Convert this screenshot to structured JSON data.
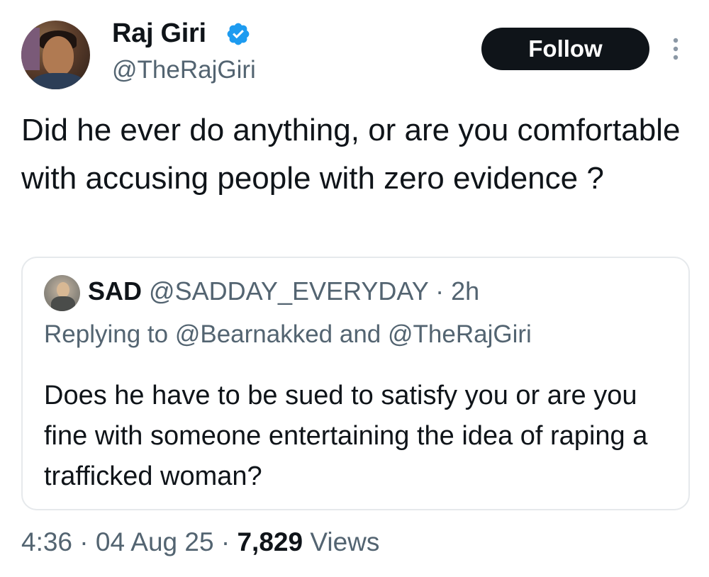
{
  "author": {
    "name": "Raj Giri",
    "handle": "@TheRajGiri",
    "verified": true
  },
  "actions": {
    "follow_label": "Follow"
  },
  "tweet": {
    "text": "Did he ever do anything, or are you comfortable with accusing people with zero evidence ?"
  },
  "quoted_tweet": {
    "name": "SAD",
    "handle": "@SADDAY_EVERYDAY",
    "separator": "·",
    "time": "2h",
    "replying_to": "Replying to @Bearnakked and @TheRajGiri",
    "text": "Does he have to be sued to satisfy you or are you fine with someone entertaining the idea of raping a trafficked woman?"
  },
  "footer": {
    "time": "4:36",
    "separator1": "·",
    "date": "04 Aug 25",
    "separator2": "·",
    "views_count": "7,829",
    "views_label": "Views"
  },
  "colors": {
    "verified_badge": "#1d9bf0",
    "follow_button_bg": "#0f1419",
    "secondary_text": "#536471",
    "quote_border": "#e6e9ec"
  }
}
